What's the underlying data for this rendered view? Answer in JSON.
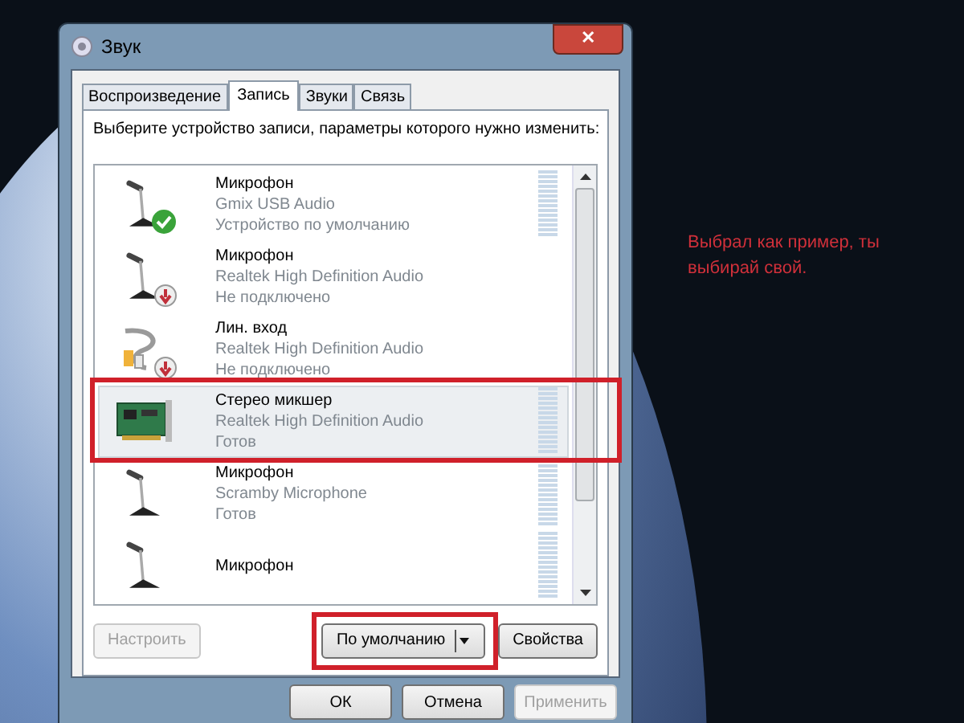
{
  "window": {
    "title": "Звук",
    "close": "✕"
  },
  "tabs": [
    {
      "label": "Воспроизведение",
      "selected": false
    },
    {
      "label": "Запись",
      "selected": true
    },
    {
      "label": "Звуки",
      "selected": false
    },
    {
      "label": "Связь",
      "selected": false
    }
  ],
  "instruction": "Выберите устройство записи, параметры которого нужно изменить:",
  "devices": [
    {
      "kind": "mic",
      "is_default": true,
      "disconnected": false,
      "name": "Микрофон",
      "driver": "Gmix USB Audio",
      "status": "Устройство по умолчанию",
      "selected": false,
      "highlighted": false
    },
    {
      "kind": "mic",
      "is_default": false,
      "disconnected": true,
      "name": "Микрофон",
      "driver": "Realtek High Definition Audio",
      "status": "Не подключено",
      "selected": false,
      "highlighted": false
    },
    {
      "kind": "line",
      "is_default": false,
      "disconnected": true,
      "name": "Лин. вход",
      "driver": "Realtek High Definition Audio",
      "status": "Не подключено",
      "selected": false,
      "highlighted": false
    },
    {
      "kind": "card",
      "is_default": false,
      "disconnected": false,
      "name": "Стерео микшер",
      "driver": "Realtek High Definition Audio",
      "status": "Готов",
      "selected": true,
      "highlighted": true
    },
    {
      "kind": "mic",
      "is_default": false,
      "disconnected": false,
      "name": "Микрофон",
      "driver": "Scramby Microphone",
      "status": "Готов",
      "selected": false,
      "highlighted": false
    },
    {
      "kind": "mic",
      "is_default": false,
      "disconnected": false,
      "name": "Микрофон",
      "selected": false,
      "highlighted": false
    }
  ],
  "panel_buttons": [
    {
      "label": "Настроить",
      "disabled": true,
      "split": false,
      "highlighted": false
    },
    {
      "label": "По умолчанию",
      "disabled": false,
      "split": true,
      "highlighted": true
    },
    {
      "label": "Свойства",
      "disabled": false,
      "split": false,
      "highlighted": false
    }
  ],
  "dialog_buttons": [
    {
      "label": "ОК",
      "disabled": false
    },
    {
      "label": "Отмена",
      "disabled": false
    },
    {
      "label": "Применить",
      "disabled": true
    }
  ],
  "annotation": "Выбрал как пример, ты выбирай свой."
}
